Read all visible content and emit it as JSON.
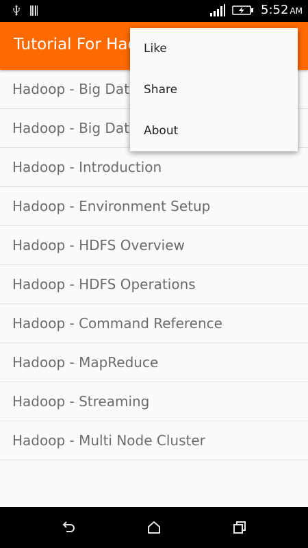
{
  "status_bar": {
    "time": "5:52",
    "ampm": "AM",
    "icons": [
      "usb-icon",
      "barcode-icon",
      "signal-icon",
      "battery-charging-icon"
    ]
  },
  "action_bar": {
    "title": "Tutorial For Hadoop"
  },
  "list": {
    "items": [
      {
        "label": "Hadoop - Big Data Overview"
      },
      {
        "label": "Hadoop - Big Data Solutions"
      },
      {
        "label": "Hadoop - Introduction"
      },
      {
        "label": "Hadoop - Environment Setup"
      },
      {
        "label": "Hadoop - HDFS Overview"
      },
      {
        "label": "Hadoop - HDFS Operations"
      },
      {
        "label": "Hadoop - Command Reference"
      },
      {
        "label": "Hadoop - MapReduce"
      },
      {
        "label": "Hadoop - Streaming"
      },
      {
        "label": "Hadoop - Multi Node Cluster"
      }
    ]
  },
  "menu": {
    "items": [
      {
        "label": "Like"
      },
      {
        "label": "Share"
      },
      {
        "label": "About"
      }
    ]
  },
  "nav_bar": {
    "icons": [
      "back-icon",
      "home-icon",
      "recents-icon"
    ]
  },
  "colors": {
    "accent": "#ff6a00",
    "list_text": "#6b6b6b",
    "menu_text": "#212121"
  }
}
